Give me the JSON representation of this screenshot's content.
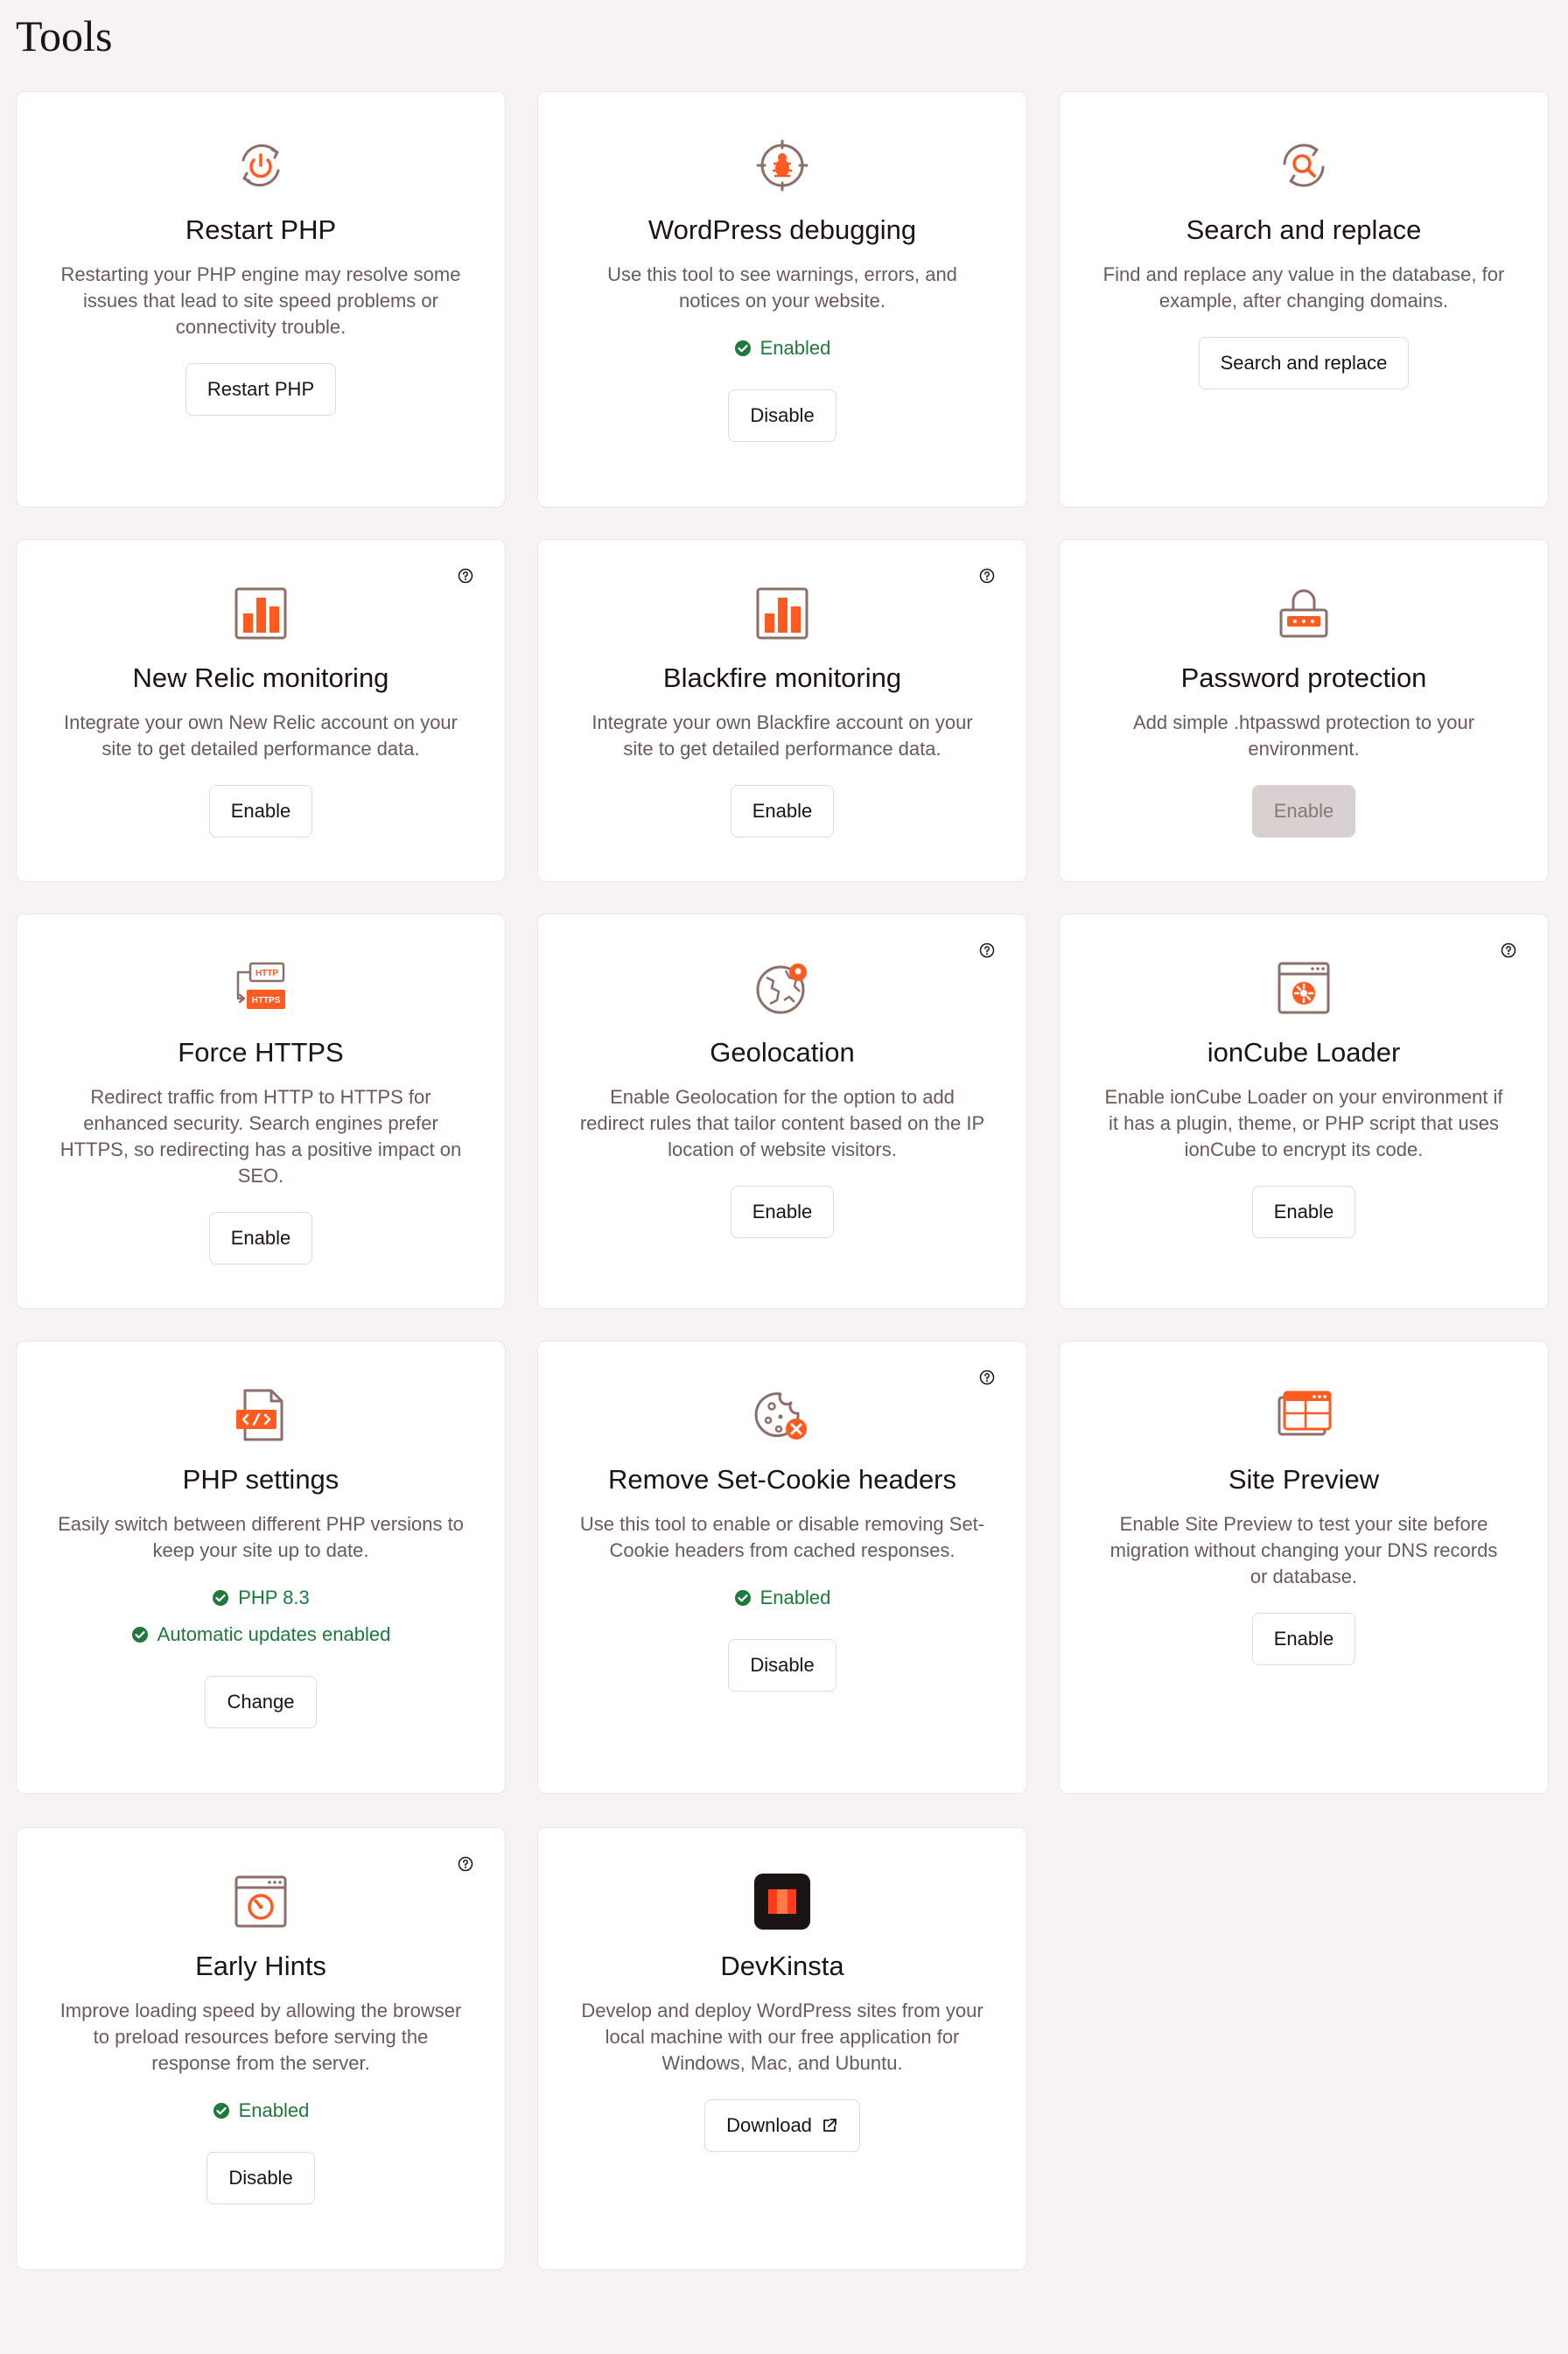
{
  "page": {
    "title": "Tools"
  },
  "colors": {
    "accent": "#ff5a1f",
    "icon_stroke": "#8c6f6a",
    "enabled": "#1d7a3c",
    "background": "#f7f3f2"
  },
  "cards": [
    {
      "icon": "restart-power-icon",
      "title": "Restart PHP",
      "description": "Restarting your PHP engine may resolve some issues that lead to site speed problems or connectivity trouble.",
      "button": "Restart PHP"
    },
    {
      "icon": "bug-icon",
      "title": "WordPress debugging",
      "description": "Use this tool to see warnings, errors, and notices on your website.",
      "status": "Enabled",
      "button": "Disable"
    },
    {
      "icon": "search-replace-icon",
      "title": "Search and replace",
      "description": "Find and replace any value in the database, for example, after changing domains.",
      "button": "Search and replace"
    },
    {
      "icon": "bar-chart-icon",
      "title": "New Relic monitoring",
      "description": "Integrate your own New Relic account on your site to get detailed performance data.",
      "button": "Enable",
      "help": true
    },
    {
      "icon": "bar-chart-icon",
      "title": "Blackfire monitoring",
      "description": "Integrate your own Blackfire account on your site to get detailed performance data.",
      "button": "Enable",
      "help": true
    },
    {
      "icon": "lock-password-icon",
      "title": "Password protection",
      "description": "Add simple .htpasswd protection to your environment.",
      "button": "Enable",
      "button_disabled": true
    },
    {
      "icon": "http-https-icon",
      "icon_text_top": "HTTP",
      "icon_text_bottom": "HTTPS",
      "title": "Force HTTPS",
      "description": "Redirect traffic from HTTP to HTTPS for enhanced security. Search engines prefer HTTPS, so redirecting has a positive impact on SEO.",
      "button": "Enable"
    },
    {
      "icon": "globe-pin-icon",
      "title": "Geolocation",
      "description": "Enable Geolocation for the option to add redirect rules that tailor content based on the IP location of website visitors.",
      "button": "Enable",
      "help": true
    },
    {
      "icon": "browser-gear-icon",
      "title": "ionCube Loader",
      "description": "Enable ionCube Loader on your environment if it has a plugin, theme, or PHP script that uses ionCube to encrypt its code.",
      "button": "Enable",
      "help": true
    },
    {
      "icon": "code-file-icon",
      "title": "PHP settings",
      "description": "Easily switch between different PHP versions to keep your site up to date.",
      "status": "PHP 8.3",
      "status2": "Automatic updates enabled",
      "button": "Change"
    },
    {
      "icon": "cookie-remove-icon",
      "title": "Remove Set-Cookie headers",
      "description": "Use this tool to enable or disable removing Set-Cookie headers from cached responses.",
      "status": "Enabled",
      "button": "Disable",
      "help": true
    },
    {
      "icon": "site-preview-icon",
      "title": "Site Preview",
      "description": "Enable Site Preview to test your site before migration without changing your DNS records or database.",
      "button": "Enable"
    },
    {
      "icon": "browser-speed-icon",
      "title": "Early Hints",
      "description": "Improve loading speed by allowing the browser to preload resources before serving the response from the server.",
      "status": "Enabled",
      "button": "Disable",
      "help": true
    },
    {
      "icon": "devkinsta-logo-icon",
      "title": "DevKinsta",
      "description": "Develop and deploy WordPress sites from your local machine with our free application for Windows, Mac, and Ubuntu.",
      "button": "Download",
      "button_icon": "external-link-icon"
    }
  ]
}
